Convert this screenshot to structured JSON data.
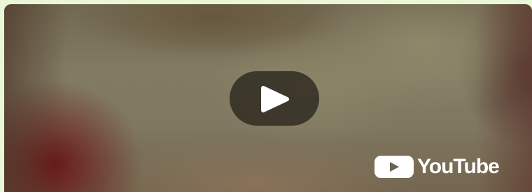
{
  "player": {
    "play_icon": "play-icon",
    "logo": {
      "icon": "youtube-icon",
      "wordmark": "YouTube"
    }
  },
  "colors": {
    "page_background": "#eaf7d6",
    "play_button_bg": "#2d2820",
    "play_arrow": "#ffffff",
    "logo": "#ffffff"
  }
}
